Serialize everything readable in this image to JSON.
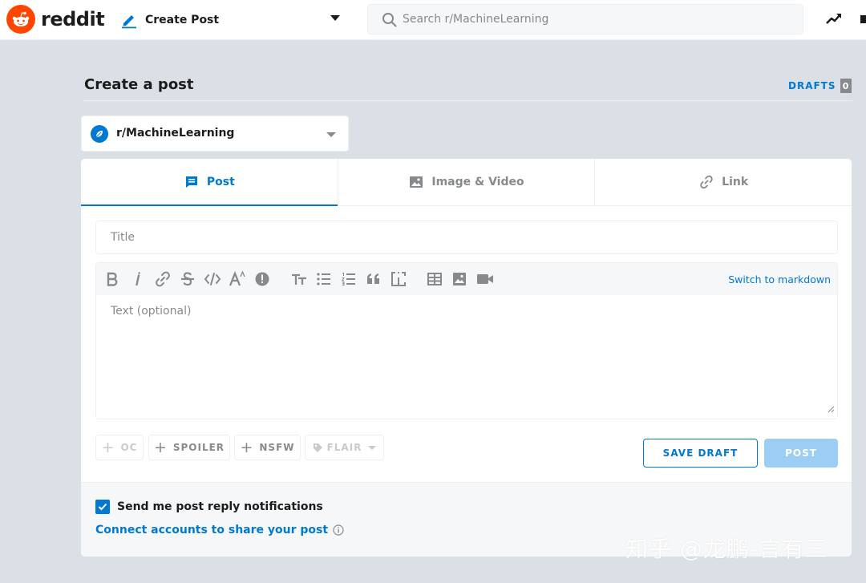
{
  "header": {
    "brand": "reddit",
    "nav_label": "Create Post",
    "search_placeholder": "Search r/MachineLearning"
  },
  "page": {
    "title": "Create a post",
    "drafts_label": "DRAFTS",
    "drafts_count": "0"
  },
  "community": {
    "name": "r/MachineLearning"
  },
  "tabs": [
    {
      "label": "Post",
      "icon": "post-icon",
      "active": true
    },
    {
      "label": "Image & Video",
      "icon": "image-icon",
      "active": false
    },
    {
      "label": "Link",
      "icon": "link-icon",
      "active": false
    }
  ],
  "form": {
    "title_placeholder": "Title",
    "body_placeholder": "Text (optional)",
    "switch_markdown": "Switch to markdown"
  },
  "toolbar_icons": [
    "bold-icon",
    "italic-icon",
    "link-icon",
    "strikethrough-icon",
    "code-icon",
    "superscript-icon",
    "spoiler-icon",
    "heading-icon",
    "bulleted-list-icon",
    "numbered-list-icon",
    "quote-icon",
    "code-block-icon",
    "table-icon",
    "image-icon",
    "video-icon"
  ],
  "tags": {
    "oc": "OC",
    "spoiler": "SPOILER",
    "nsfw": "NSFW",
    "flair": "FLAIR"
  },
  "actions": {
    "save_draft": "SAVE DRAFT",
    "post": "POST"
  },
  "footer": {
    "notify_label": "Send me post reply notifications",
    "notify_checked": true,
    "connect_label": "Connect accounts to share your post"
  },
  "watermark": "知乎 @龙鹏-言有三",
  "colors": {
    "brand": "#ff4500",
    "accent": "#0079d3",
    "background": "#dae0e6",
    "muted": "#878a8c",
    "post_disabled": "#9ccef3"
  }
}
